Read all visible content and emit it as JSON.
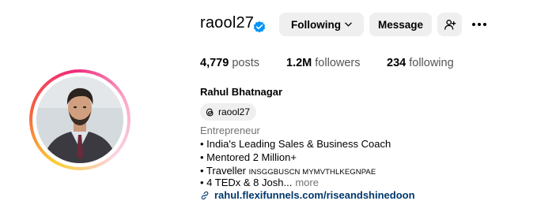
{
  "profile": {
    "username": "raool27",
    "verified": true,
    "full_name": "Rahul Bhatnagar",
    "threads_handle": "raool27",
    "category": "Entrepreneur"
  },
  "actions": {
    "following_label": "Following",
    "message_label": "Message"
  },
  "stats": {
    "posts_count": "4,779",
    "posts_label": "posts",
    "followers_count": "1.2M",
    "followers_label": "followers",
    "following_count": "234",
    "following_label": "following"
  },
  "bio": {
    "line1": "• India's Leading Sales & Business Coach",
    "line2": "• Mentored 2 Million+",
    "line3_prefix": "• Traveller ",
    "line3_small": "INSGGBUSCN MYMVTHLKEGNPAE",
    "line4": "• 4 TEDx & 8 Josh...",
    "more_label": "more",
    "link": "rahul.flexifunnels.com/riseandshinedoon"
  },
  "colors": {
    "verified_badge": "#0095f6",
    "button_bg": "#efefef",
    "link": "#00376b",
    "secondary_text": "#737373"
  },
  "icons": {
    "verified": "verified-badge-icon",
    "chevron": "chevron-down-icon",
    "add_user": "add-user-icon",
    "more": "more-options-icon",
    "threads": "threads-icon",
    "link": "link-icon"
  }
}
